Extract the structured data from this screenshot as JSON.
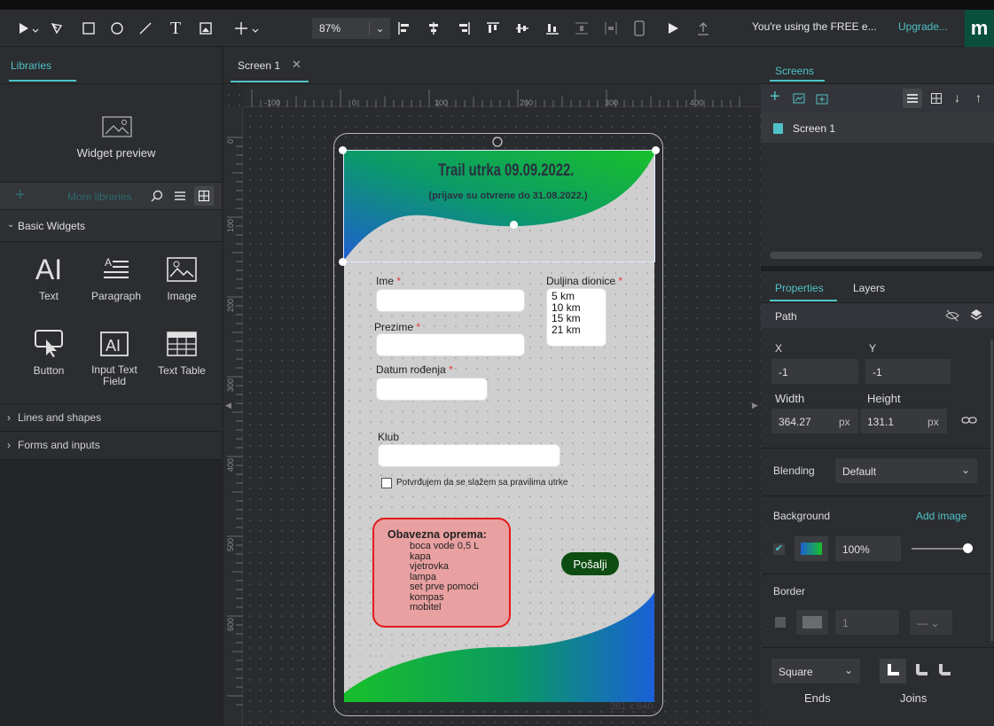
{
  "toolbar": {
    "zoom": "87%",
    "free_text": "You're using the FREE e...",
    "upgrade": "Upgrade...",
    "logo": "m"
  },
  "left": {
    "tab": "Libraries",
    "widget_preview": "Widget preview",
    "more_libraries": "More libraries",
    "basic_widgets": "Basic Widgets",
    "widgets": [
      {
        "label": "Text"
      },
      {
        "label": "Paragraph"
      },
      {
        "label": "Image"
      },
      {
        "label": "Button"
      },
      {
        "label": "Input Text Field"
      },
      {
        "label": "Text Table"
      }
    ],
    "sections": [
      "Lines and shapes",
      "Forms and inputs"
    ]
  },
  "canvas": {
    "tab": "Screen 1",
    "ruler_h": [
      "-100",
      "0",
      "100",
      "200",
      "300",
      "400"
    ],
    "ruler_v": [
      "0",
      "100",
      "200",
      "300",
      "400",
      "500",
      "600"
    ],
    "size": "361 x 640"
  },
  "form": {
    "title": "Trail utrka 09.09.2022.",
    "subtitle": "(prijave su otvrene do 31.08.2022.)",
    "ime": "Ime",
    "prezime": "Prezime",
    "datum": "Datum rođenja",
    "duljina": "Duljina dionice",
    "klub": "Klub",
    "options": [
      "5 km",
      "10 km",
      "15 km",
      "21 km"
    ],
    "agree": "Potvrđujem da se slažem sa pravilima utrke",
    "oprema_title": "Obavezna oprema:",
    "oprema": [
      "boca vode 0,5 L",
      "kapa",
      "vjetrovka",
      "lampa",
      "set prve pomoći",
      "kompas",
      "mobitel"
    ],
    "send": "Pošalji",
    "required_mark": "*"
  },
  "right": {
    "tab_screens": "Screens",
    "screen_item": "Screen 1",
    "tab_properties": "Properties",
    "tab_layers": "Layers",
    "element": "Path",
    "x_label": "X",
    "y_label": "Y",
    "x": "-1",
    "y": "-1",
    "w_label": "Width",
    "h_label": "Height",
    "width": "364.27",
    "height": "131.1",
    "px": "px",
    "blending_label": "Blending",
    "blending": "Default",
    "background_label": "Background",
    "add_image": "Add image",
    "opacity": "100%",
    "border_label": "Border",
    "border_value": "1",
    "ends_value": "Square",
    "ends_label": "Ends",
    "joins_label": "Joins"
  },
  "colors": {
    "accent": "#4fc3c7",
    "send_button": "#0d4d12",
    "oprema_border": "#e21b1b"
  }
}
